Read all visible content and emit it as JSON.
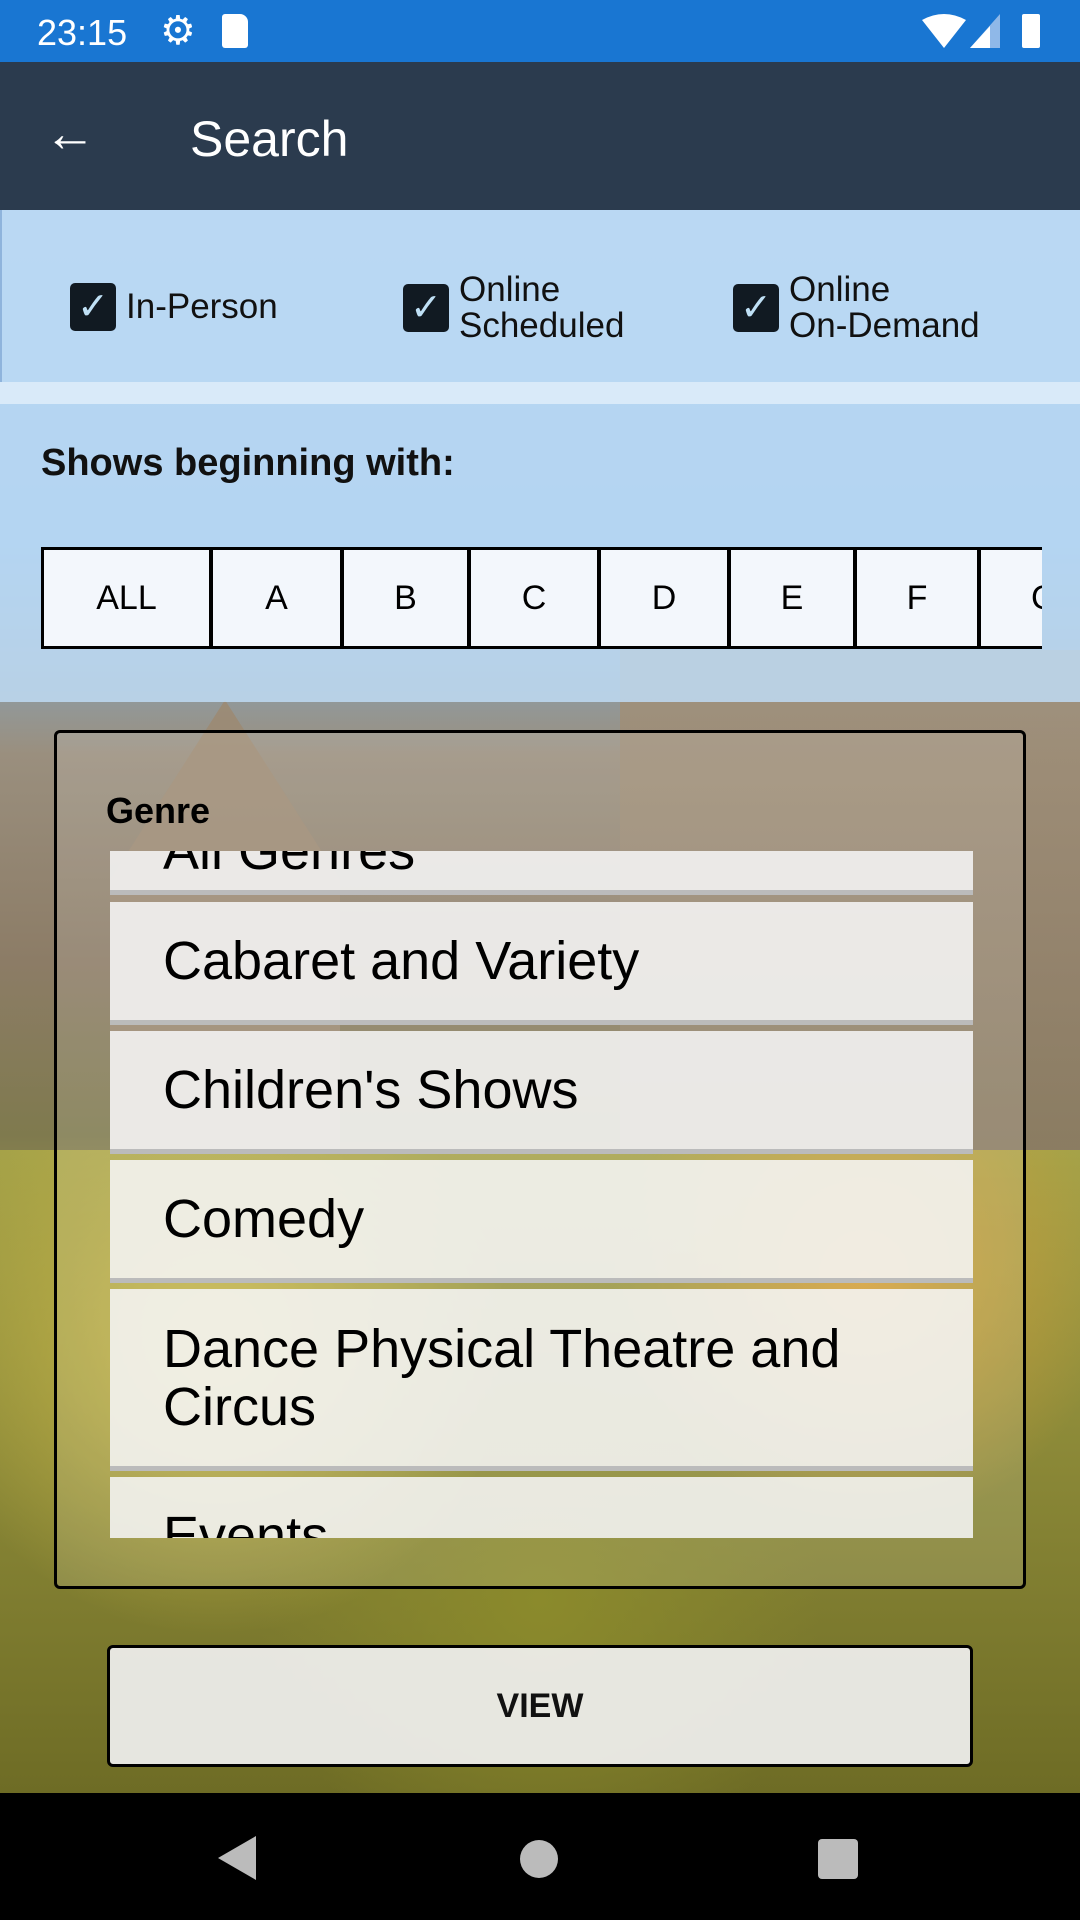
{
  "status_bar": {
    "time": "23:15",
    "icons": [
      "settings-icon",
      "sd-card-icon",
      "wifi-icon",
      "signal-icon",
      "battery-icon"
    ]
  },
  "toolbar": {
    "title": "Search",
    "back_icon": "arrow-back-icon"
  },
  "filters": [
    {
      "label": "In-Person",
      "checked": true
    },
    {
      "label_line1": "Online",
      "label_line2": "Scheduled",
      "checked": true
    },
    {
      "label_line1": "Online",
      "label_line2": "On-Demand",
      "checked": true
    }
  ],
  "shows_label": "Shows beginning with:",
  "letters": [
    "ALL",
    "A",
    "B",
    "C",
    "D",
    "E",
    "F",
    "G"
  ],
  "genre": {
    "label": "Genre",
    "items": [
      "All Genres",
      "Cabaret and Variety",
      "Children's Shows",
      "Comedy",
      "Dance Physical Theatre and Circus",
      "Events"
    ]
  },
  "view_label": "VIEW"
}
